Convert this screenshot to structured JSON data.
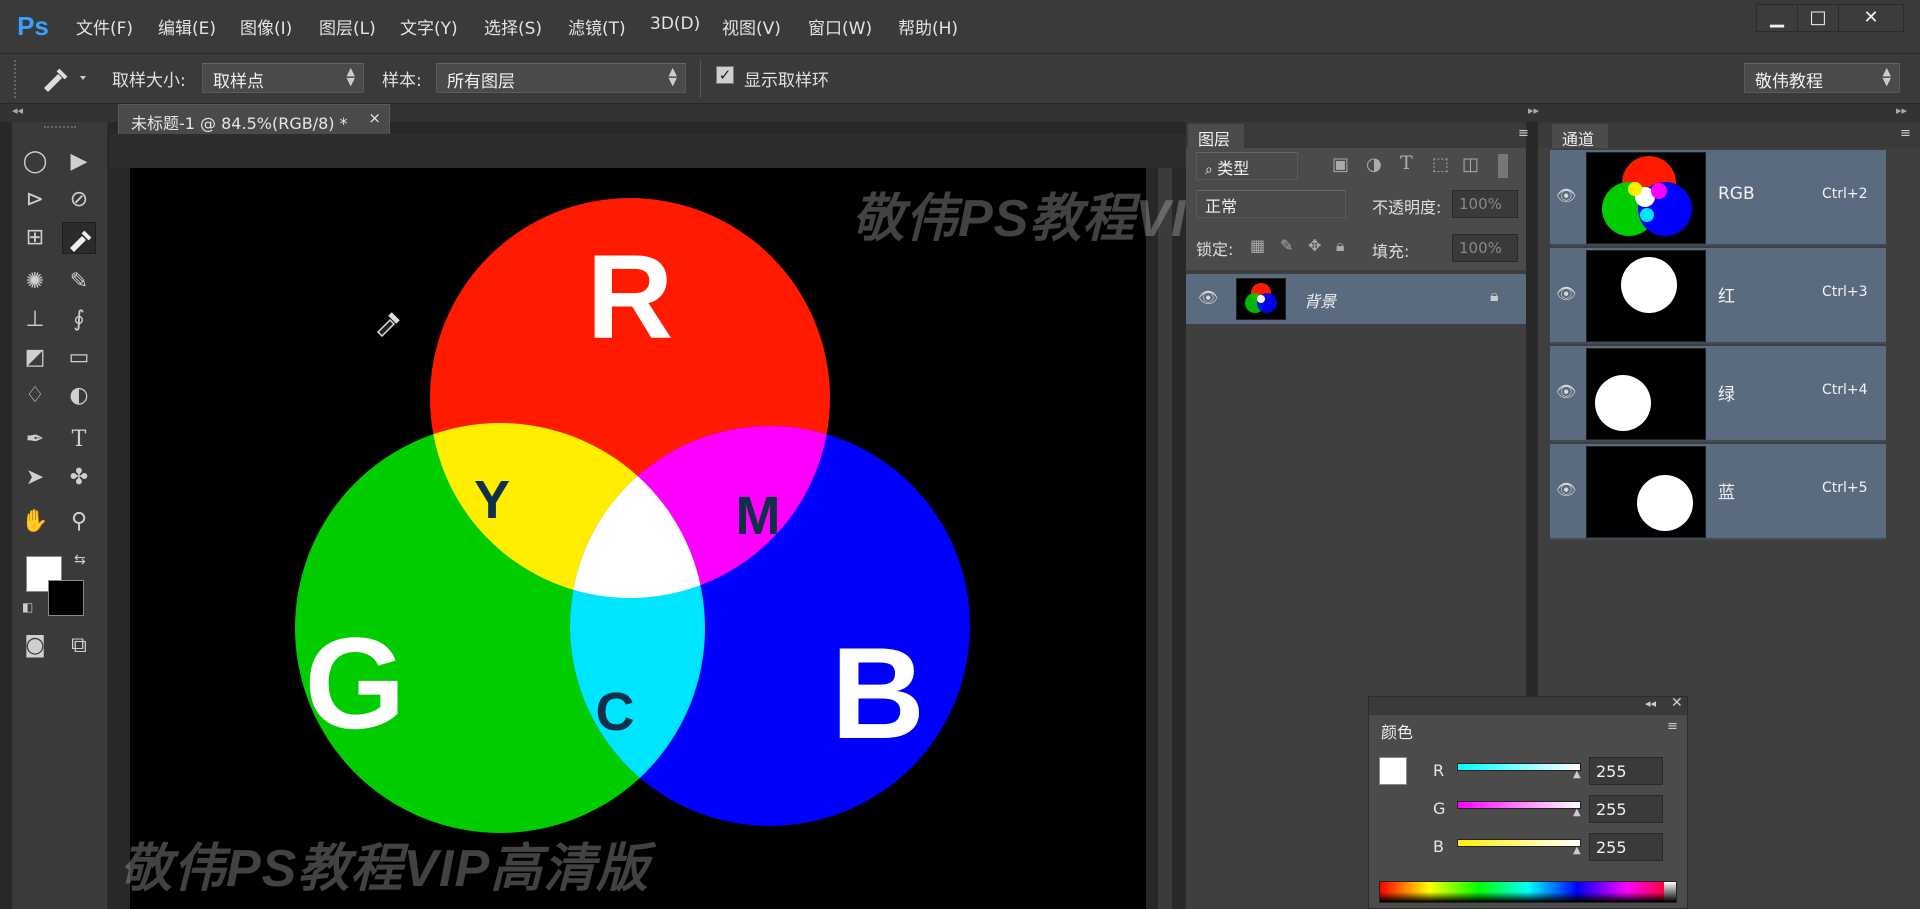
{
  "app": {
    "logo": "Ps",
    "menu": [
      "文件(F)",
      "编辑(E)",
      "图像(I)",
      "图层(L)",
      "文字(Y)",
      "选择(S)",
      "滤镜(T)",
      "3D(D)",
      "视图(V)",
      "窗口(W)",
      "帮助(H)"
    ],
    "window_controls": [
      "▁",
      "□",
      "✕"
    ]
  },
  "options": {
    "sample_size_label": "取样大小:",
    "sample_size_value": "取样点",
    "sample_label": "样本:",
    "sample_value": "所有图层",
    "show_ring_label": "显示取样环",
    "show_ring_checked": true,
    "workspace_value": "敬伟教程"
  },
  "document": {
    "tab_title": "未标题-1 @ 84.5%(RGB/8) *",
    "tab_close": "×",
    "circle_labels": {
      "r": "R",
      "g": "G",
      "b": "B",
      "y": "Y",
      "m": "M",
      "c": "C"
    },
    "colors": {
      "red": "#ff1a00",
      "green": "#00cc00",
      "blue": "#0000ff",
      "yellow": "#ffee00",
      "magenta": "#ff00ff",
      "cyan": "#00e5ff",
      "white": "#ffffff"
    }
  },
  "watermark": "敬伟PS教程VIP高清版",
  "layers_panel": {
    "tab": "图层",
    "filter_label": "类型",
    "blend_mode": "正常",
    "opacity_label": "不透明度:",
    "opacity_value": "100%",
    "lock_label": "锁定:",
    "fill_label": "填充:",
    "fill_value": "100%",
    "layers": [
      {
        "name": "背景",
        "locked": true
      }
    ]
  },
  "channels_panel": {
    "tab": "通道",
    "channels": [
      {
        "name": "RGB",
        "shortcut": "Ctrl+2"
      },
      {
        "name": "红",
        "shortcut": "Ctrl+3"
      },
      {
        "name": "绿",
        "shortcut": "Ctrl+4"
      },
      {
        "name": "蓝",
        "shortcut": "Ctrl+5"
      }
    ]
  },
  "color_panel": {
    "tab": "颜色",
    "r_label": "R",
    "r_value": "255",
    "g_label": "G",
    "g_value": "255",
    "b_label": "B",
    "b_value": "255"
  }
}
